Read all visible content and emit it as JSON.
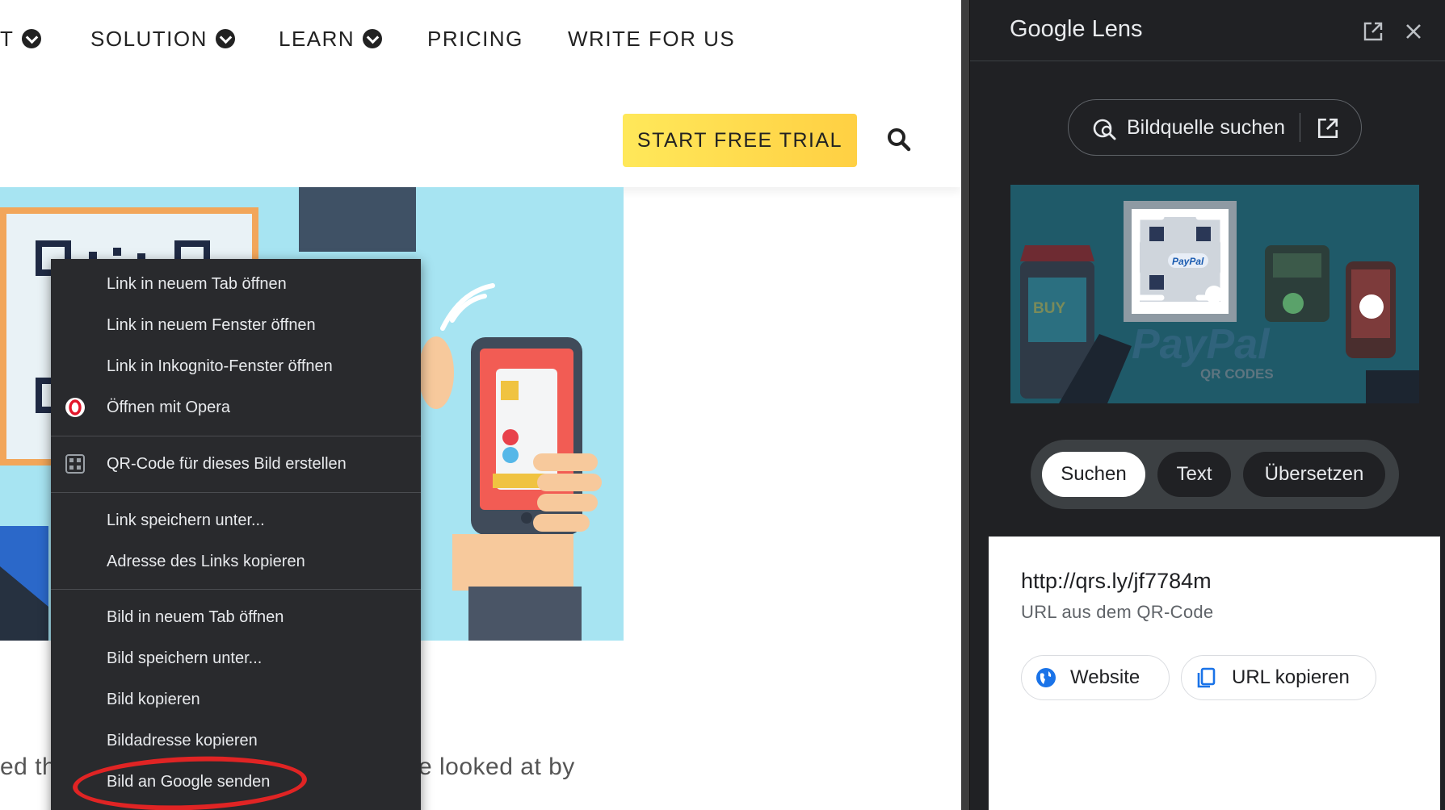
{
  "nav": {
    "items": [
      {
        "label": "T",
        "has_dropdown": true
      },
      {
        "label": "SOLUTION",
        "has_dropdown": true
      },
      {
        "label": "LEARN",
        "has_dropdown": true
      },
      {
        "label": "PRICING",
        "has_dropdown": false
      },
      {
        "label": "WRITE FOR US",
        "has_dropdown": false
      }
    ],
    "cta_label": "START FREE TRIAL",
    "search_icon": "search-icon"
  },
  "hero": {
    "illustration": "phone-payment-illustration"
  },
  "body": {
    "text_left": "ed th",
    "text_right": "e looked at by"
  },
  "context_menu": {
    "groups": [
      [
        {
          "label": "Link in neuem Tab öffnen",
          "icon": null
        },
        {
          "label": "Link in neuem Fenster öffnen",
          "icon": null
        },
        {
          "label": "Link in Inkognito-Fenster öffnen",
          "icon": null
        },
        {
          "label": "Öffnen mit Opera",
          "icon": "opera-icon"
        }
      ],
      [
        {
          "label": "QR-Code für dieses Bild erstellen",
          "icon": "qr-code-icon"
        }
      ],
      [
        {
          "label": "Link speichern unter...",
          "icon": null
        },
        {
          "label": "Adresse des Links kopieren",
          "icon": null
        }
      ],
      [
        {
          "label": "Bild in neuem Tab öffnen",
          "icon": null
        },
        {
          "label": "Bild speichern unter...",
          "icon": null
        },
        {
          "label": "Bild kopieren",
          "icon": null
        },
        {
          "label": "Bildadresse kopieren",
          "icon": null
        },
        {
          "label": "Bild an Google senden",
          "icon": null,
          "highlighted": true
        }
      ]
    ]
  },
  "lens": {
    "title": "Google Lens",
    "source_button": "Bildquelle suchen",
    "tabs": [
      {
        "label": "Suchen",
        "selected": true
      },
      {
        "label": "Text",
        "selected": false
      },
      {
        "label": "Übersetzen",
        "selected": false
      }
    ],
    "result_url": "http://qrs.ly/jf7784m",
    "result_caption": "URL aus dem QR-Code",
    "actions": [
      {
        "label": "Website",
        "icon": "globe-icon"
      },
      {
        "label": "URL kopieren",
        "icon": "copy-icon"
      }
    ],
    "thumbnail_words": {
      "buy": "BUY",
      "brand": "PayPal",
      "qr_caption": "QR CODES"
    }
  },
  "colors": {
    "cta": "#ffd84a",
    "hero_bg": "#a7e4f2",
    "menu_bg": "#292a2d",
    "lens_bg": "#202124",
    "highlight_circle": "#e02424",
    "link_blue": "#1a73e8"
  }
}
